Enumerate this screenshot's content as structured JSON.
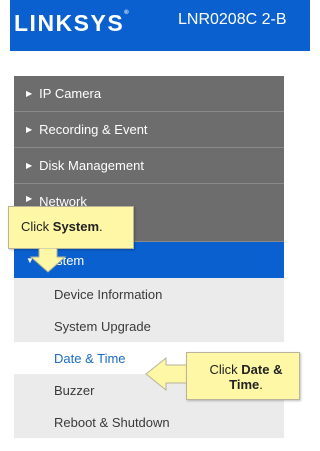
{
  "header": {
    "logo": "LINKSYS",
    "logo_mark": "®",
    "model": "LNR0208C 2-B"
  },
  "menu": [
    {
      "label": "IP Camera"
    },
    {
      "label": "Recording & Event"
    },
    {
      "label": "Disk Management"
    },
    {
      "label": "Network"
    },
    {
      "label": "System"
    }
  ],
  "submenu": [
    {
      "label": "Device Information"
    },
    {
      "label": "System Upgrade"
    },
    {
      "label": "Date & Time"
    },
    {
      "label": "Buzzer"
    },
    {
      "label": "Reboot & Shutdown"
    }
  ],
  "callouts": {
    "system": {
      "prefix": "Click ",
      "strong": "System",
      "suffix": "."
    },
    "date_time": {
      "prefix": "Click ",
      "strong": "Date & Time",
      "suffix": "."
    }
  },
  "colors": {
    "brand_blue": "#0a60ce",
    "menu_gray": "#6d6d6d",
    "submenu_bg": "#ebebeb",
    "callout": "#fdf7a6",
    "link": "#1a6bc4"
  },
  "icons": {
    "collapsed": "triangle-right-icon",
    "expanded": "triangle-down-icon"
  }
}
